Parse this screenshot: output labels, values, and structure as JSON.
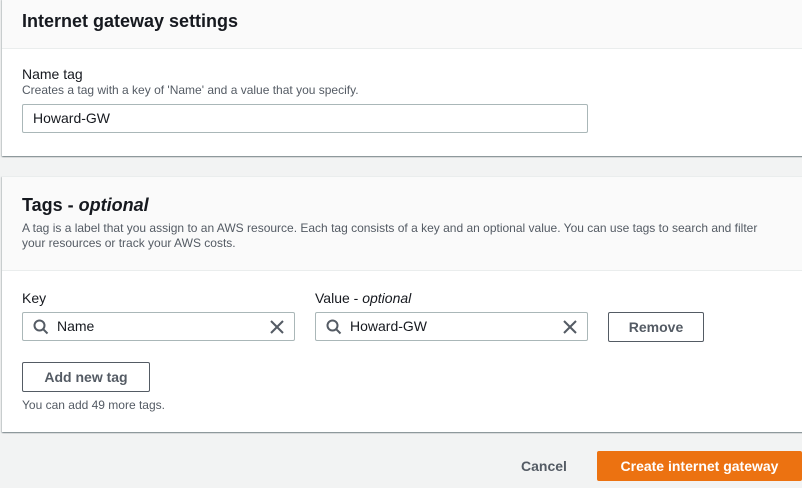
{
  "settings_panel": {
    "title": "Internet gateway settings",
    "name_tag_label": "Name tag",
    "name_tag_description": "Creates a tag with a key of 'Name' and a value that you specify.",
    "name_tag_value": "Howard-GW"
  },
  "tags_panel": {
    "title": "Tags - ",
    "title_optional": "optional",
    "description": "A tag is a label that you assign to an AWS resource. Each tag consists of a key and an optional value. You can use tags to search and filter your resources or track your AWS costs.",
    "key_label": "Key",
    "value_label": "Value - ",
    "value_label_optional": "optional",
    "rows": [
      {
        "key": "Name",
        "value": "Howard-GW"
      }
    ],
    "remove_label": "Remove",
    "add_label": "Add new tag",
    "hint": "You can add 49 more tags."
  },
  "footer": {
    "cancel_label": "Cancel",
    "create_label": "Create internet gateway"
  },
  "icons": {
    "search": "search-icon",
    "clear": "close-icon"
  },
  "colors": {
    "primary": "#ec7211",
    "text": "#16191f",
    "secondary_text": "#545b64",
    "border": "#aab7b8",
    "background": "#f2f3f3"
  }
}
